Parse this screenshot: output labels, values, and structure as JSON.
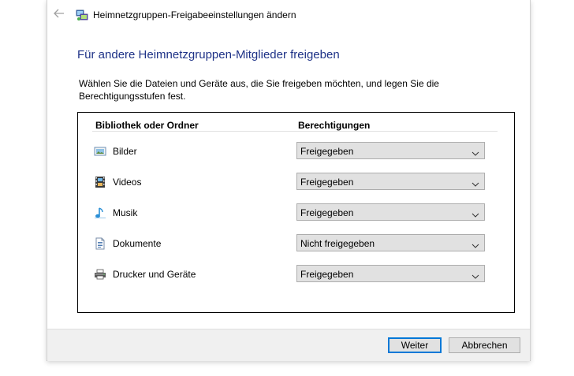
{
  "window": {
    "title": "Heimnetzgruppen-Freigabeeinstellungen ändern"
  },
  "main": {
    "heading": "Für andere Heimnetzgruppen-Mitglieder freigeben",
    "description": "Wählen Sie die Dateien und Geräte aus, die Sie freigeben möchten, und legen Sie die Berechtigungsstufen fest."
  },
  "table": {
    "col_library": "Bibliothek oder Ordner",
    "col_permissions": "Berechtigungen",
    "rows": [
      {
        "label": "Bilder",
        "icon": "pictures-icon",
        "value": "Freigegeben"
      },
      {
        "label": "Videos",
        "icon": "videos-icon",
        "value": "Freigegeben"
      },
      {
        "label": "Musik",
        "icon": "music-icon",
        "value": "Freigegeben"
      },
      {
        "label": "Dokumente",
        "icon": "documents-icon",
        "value": "Nicht freigegeben"
      },
      {
        "label": "Drucker und Geräte",
        "icon": "printer-icon",
        "value": "Freigegeben"
      }
    ]
  },
  "footer": {
    "next_label": "Weiter",
    "cancel_label": "Abbrechen"
  },
  "colors": {
    "heading": "#1e3287",
    "accent": "#0078d7"
  }
}
